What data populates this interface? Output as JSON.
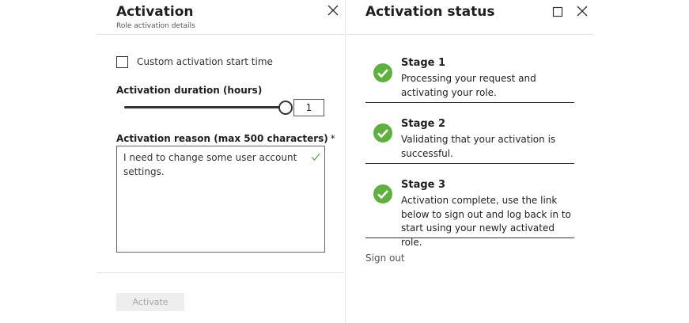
{
  "activation_blade": {
    "title": "Activation",
    "subtitle": "Role activation details",
    "custom_start_label": "Custom activation start time",
    "custom_start_checked": false,
    "duration_label": "Activation duration (hours)",
    "duration_value": "1",
    "duration_slider_level": 1.0,
    "reason_label": "Activation reason (max 500 characters)",
    "reason_required_marker": "*",
    "reason_value": "I need to change some user account settings.",
    "activate_button": "Activate",
    "icons": {
      "close": "close-icon",
      "valid": "checkmark-icon"
    },
    "colors": {
      "valid_check": "#5ea841",
      "disabled_button_bg": "#eeeeee",
      "disabled_button_text": "#a6a6a6"
    }
  },
  "status_blade": {
    "title": "Activation status",
    "stages": [
      {
        "title": "Stage 1",
        "description": "Processing your request and activating your role."
      },
      {
        "title": "Stage 2",
        "description": "Validating that your activation is successful."
      },
      {
        "title": "Stage 3",
        "description": "Activation complete, use the link below to sign out and log back in to start using your newly activated role."
      }
    ],
    "sign_out_link": "Sign out",
    "icons": {
      "maximize": "maximize-icon",
      "close": "close-icon",
      "stage_complete": "checkmark-circle-icon"
    },
    "colors": {
      "stage_complete": "#5db13c"
    }
  }
}
